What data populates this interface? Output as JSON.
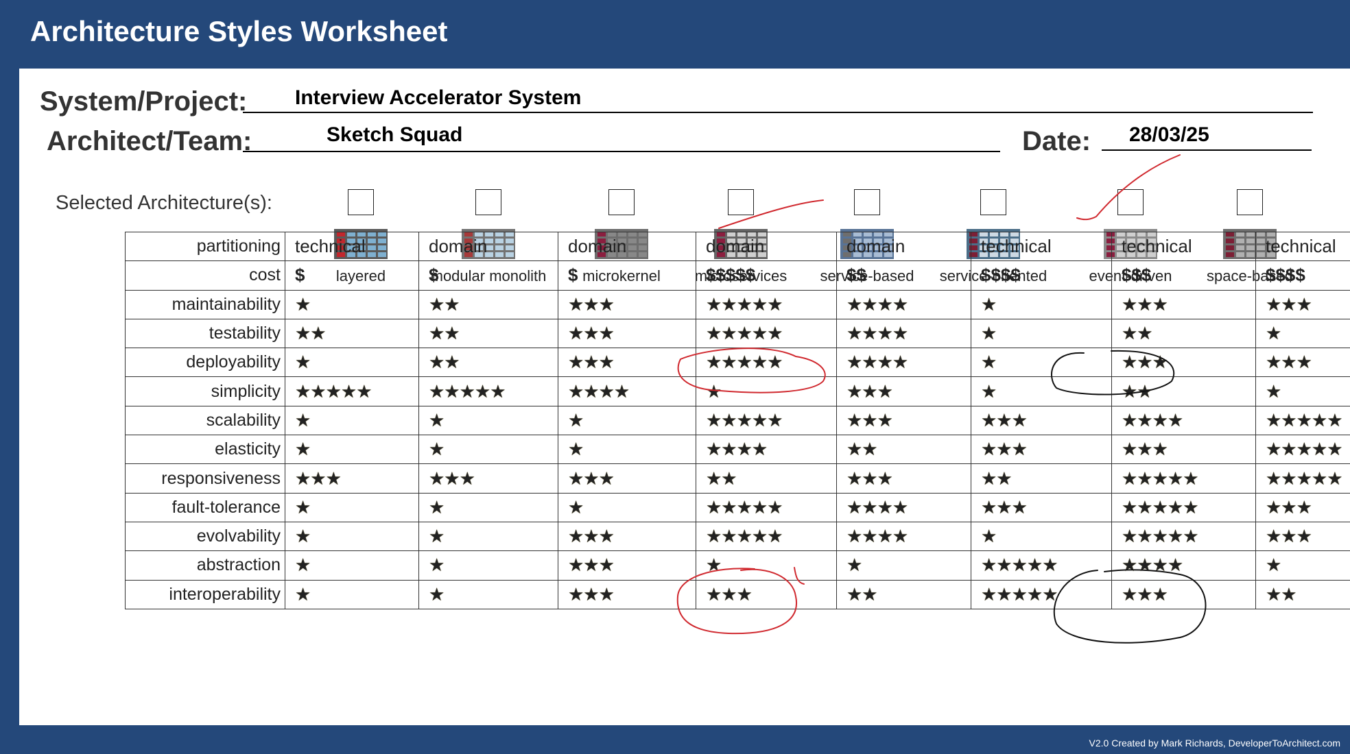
{
  "header": {
    "title": "Architecture Styles Worksheet"
  },
  "form": {
    "system_label": "System/Project:",
    "system_value": "Interview Accelerator System",
    "team_label": "Architect/Team:",
    "team_value": "Sketch Squad",
    "date_label": "Date:",
    "date_value": "28/03/25",
    "selected_label": "Selected Architecture(s):"
  },
  "architectures": [
    {
      "name": "layered",
      "checked": false
    },
    {
      "name": "modular monolith",
      "checked": false
    },
    {
      "name": "microkernel",
      "checked": false
    },
    {
      "name": "microservices",
      "checked": false
    },
    {
      "name": "service-based",
      "checked": false
    },
    {
      "name": "service-oriented",
      "checked": false
    },
    {
      "name": "event-driven",
      "checked": false
    },
    {
      "name": "space-based",
      "checked": false
    }
  ],
  "table": {
    "rows": [
      {
        "label": "partitioning",
        "kind": "text",
        "cells": [
          "technical",
          "domain",
          "domain",
          "domain",
          "domain",
          "technical",
          "technical",
          "technical"
        ]
      },
      {
        "label": "cost",
        "kind": "cost",
        "cells": [
          "$",
          "$",
          "$",
          "$$$$$",
          "$$",
          "$$$$",
          "$$$",
          "$$$$"
        ]
      },
      {
        "label": "maintainability",
        "kind": "stars",
        "cells": [
          "★",
          "★★",
          "★★★",
          "★★★★★",
          "★★★★",
          "★",
          "★★★",
          "★★★"
        ]
      },
      {
        "label": "testability",
        "kind": "stars",
        "cells": [
          "★★",
          "★★",
          "★★★",
          "★★★★★",
          "★★★★",
          "★",
          "★★",
          "★"
        ]
      },
      {
        "label": "deployability",
        "kind": "stars",
        "cells": [
          "★",
          "★★",
          "★★★",
          "★★★★★",
          "★★★★",
          "★",
          "★★★",
          "★★★"
        ]
      },
      {
        "label": "simplicity",
        "kind": "stars",
        "cells": [
          "★★★★★",
          "★★★★★",
          "★★★★",
          "★",
          "★★★",
          "★",
          "★★",
          "★"
        ]
      },
      {
        "label": "scalability",
        "kind": "stars",
        "cells": [
          "★",
          "★",
          "★",
          "★★★★★",
          "★★★",
          "★★★",
          "★★★★",
          "★★★★★"
        ]
      },
      {
        "label": "elasticity",
        "kind": "stars",
        "cells": [
          "★",
          "★",
          "★",
          "★★★★",
          "★★",
          "★★★",
          "★★★",
          "★★★★★"
        ]
      },
      {
        "label": "responsiveness",
        "kind": "stars",
        "cells": [
          "★★★",
          "★★★",
          "★★★",
          "★★",
          "★★★",
          "★★",
          "★★★★★",
          "★★★★★"
        ]
      },
      {
        "label": "fault-tolerance",
        "kind": "stars",
        "cells": [
          "★",
          "★",
          "★",
          "★★★★★",
          "★★★★",
          "★★★",
          "★★★★★",
          "★★★"
        ]
      },
      {
        "label": "evolvability",
        "kind": "stars",
        "cells": [
          "★",
          "★",
          "★★★",
          "★★★★★",
          "★★★★",
          "★",
          "★★★★★",
          "★★★"
        ]
      },
      {
        "label": "abstraction",
        "kind": "stars",
        "cells": [
          "★",
          "★",
          "★★★",
          "★",
          "★",
          "★★★★★",
          "★★★★",
          "★"
        ]
      },
      {
        "label": "interoperability",
        "kind": "stars",
        "cells": [
          "★",
          "★",
          "★★★",
          "★★★",
          "★★",
          "★★★★★",
          "★★★",
          "★★"
        ]
      }
    ]
  },
  "footer": {
    "credit": "V2.0 Created by Mark Richards, DeveloperToArchitect.com"
  },
  "colors": {
    "header_bg": "#24487a",
    "cost": "#2f8a4a",
    "star": "#d4b22a",
    "red_marker": "#d0282e",
    "black_marker": "#111111"
  }
}
